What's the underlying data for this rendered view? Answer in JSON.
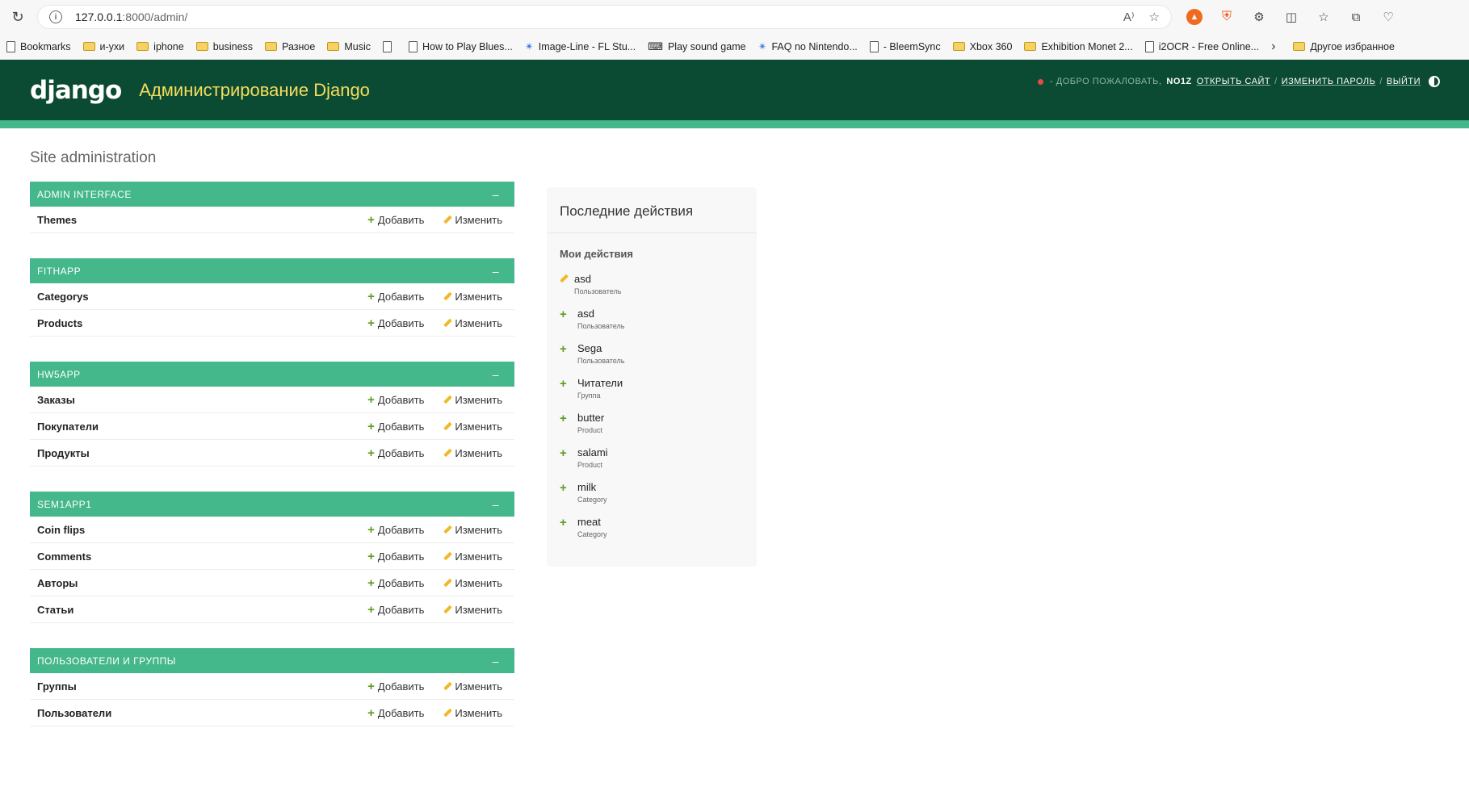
{
  "browser": {
    "url_host": "127.0.0.1",
    "url_path": ":8000/admin/",
    "bookmarks": [
      {
        "label": "Bookmarks",
        "kind": "page"
      },
      {
        "label": "и-ухи",
        "kind": "folder"
      },
      {
        "label": "iphone",
        "kind": "folder"
      },
      {
        "label": "business",
        "kind": "folder"
      },
      {
        "label": "Разное",
        "kind": "folder"
      },
      {
        "label": "Music",
        "kind": "folder"
      },
      {
        "label": "",
        "kind": "page"
      },
      {
        "label": "How to Play Blues...",
        "kind": "page"
      },
      {
        "label": "Image-Line - FL Stu...",
        "kind": "star"
      },
      {
        "label": "Play sound game",
        "kind": "gamepad"
      },
      {
        "label": "FAQ no Nintendo...",
        "kind": "star"
      },
      {
        "label": "- BleemSync",
        "kind": "page"
      },
      {
        "label": "Xbox 360",
        "kind": "folder"
      },
      {
        "label": "Exhibition Monet 2...",
        "kind": "folder"
      },
      {
        "label": "i2OCR - Free Online...",
        "kind": "page"
      }
    ],
    "other_bookmarks": "Другое избранное"
  },
  "header": {
    "logo": "django",
    "title": "Администрирование Django",
    "welcome": "ДОБРО ПОЖАЛОВАТЬ,",
    "username": "NO1Z",
    "view_site": "ОТКРЫТЬ САЙТ",
    "change_password": "ИЗМЕНИТЬ ПАРОЛЬ",
    "logout": "ВЫЙТИ",
    "dash": "-"
  },
  "page_title": "Site administration",
  "labels": {
    "add": "Добавить",
    "change": "Изменить",
    "collapse": "–"
  },
  "modules": [
    {
      "caption": "ADMIN INTERFACE",
      "models": [
        "Themes"
      ]
    },
    {
      "caption": "FITHAPP",
      "models": [
        "Categorys",
        "Products"
      ]
    },
    {
      "caption": "HW5APP",
      "models": [
        "Заказы",
        "Покупатели",
        "Продукты"
      ]
    },
    {
      "caption": "SEM1APP1",
      "models": [
        "Coin flips",
        "Comments",
        "Авторы",
        "Статьи"
      ]
    },
    {
      "caption": "ПОЛЬЗОВАТЕЛИ И ГРУППЫ",
      "models": [
        "Группы",
        "Пользователи"
      ]
    }
  ],
  "recent": {
    "title": "Последние действия",
    "subtitle": "Мои действия",
    "items": [
      {
        "kind": "change",
        "object": "asd",
        "type": "Пользователь"
      },
      {
        "kind": "add",
        "object": "asd",
        "type": "Пользователь"
      },
      {
        "kind": "add",
        "object": "Sega",
        "type": "Пользователь"
      },
      {
        "kind": "add",
        "object": "Читатели",
        "type": "Группа"
      },
      {
        "kind": "add",
        "object": "butter",
        "type": "Product"
      },
      {
        "kind": "add",
        "object": "salami",
        "type": "Product"
      },
      {
        "kind": "add",
        "object": "milk",
        "type": "Category"
      },
      {
        "kind": "add",
        "object": "meat",
        "type": "Category"
      }
    ]
  }
}
